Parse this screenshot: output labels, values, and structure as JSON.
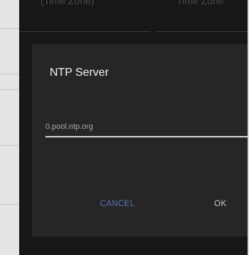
{
  "background": {
    "setting_left_text": "(Time Zone)",
    "setting_right_text": "Time Zone"
  },
  "dialog": {
    "title": "NTP Server",
    "input_value": "0.pool.ntp.org",
    "cancel_label": "CANCEL",
    "ok_label": "OK"
  },
  "colors": {
    "dialog_background": "#262626",
    "title_text": "#f2f2f2",
    "input_underline": "#d7d7d7",
    "cancel_accent": "#5b6fb8",
    "ok_text": "#c8c8c8"
  }
}
